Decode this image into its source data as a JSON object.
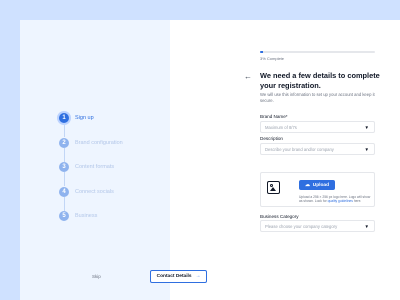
{
  "sidebar": {
    "steps": [
      {
        "number": "1",
        "label": "Sign up",
        "state": "active"
      },
      {
        "number": "2",
        "label": "Brand configuration",
        "state": "pending"
      },
      {
        "number": "3",
        "label": "Content formats",
        "state": "pending"
      },
      {
        "number": "4",
        "label": "Connect socials",
        "state": "pending"
      },
      {
        "number": "5",
        "label": "Business",
        "state": "pending"
      }
    ]
  },
  "progress": {
    "percent": 3,
    "text": "3% Complete"
  },
  "header": {
    "back_icon": "arrow-left-icon",
    "title": "We need a few details to complete your registration.",
    "subtitle": "We will use this information to set up your account and keep it secure."
  },
  "form": {
    "brand_name": {
      "label": "Brand Name",
      "required_mark": "*",
      "placeholder": "Maximum of 8/7s"
    },
    "description": {
      "label": "Description",
      "placeholder": "Describe your brand and/or company"
    },
    "upload": {
      "button_label": "Upload",
      "hint": "Upload a 256 × 256 px logo here. Logo will show as shown. Look for",
      "hint_link": "quality guidelines",
      "hint_end": "here."
    },
    "business_category": {
      "label": "Business Category",
      "placeholder": "Please choose your company category"
    }
  },
  "footer": {
    "skip_label": "Skip",
    "next_label": "Contact Details",
    "next_icon": "arrow-right-icon"
  },
  "colors": {
    "accent": "#2f6fe0",
    "sidebar_bg": "#eef5ff",
    "page_bg": "#cfe1ff"
  }
}
